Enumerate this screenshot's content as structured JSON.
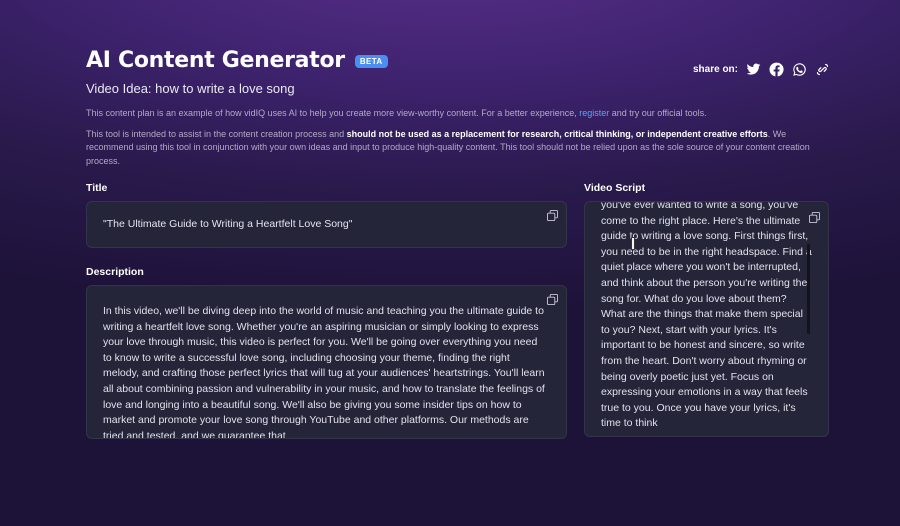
{
  "app": {
    "title": "AI Content Generator",
    "badge": "BETA"
  },
  "share": {
    "label": "share on:",
    "icons": [
      "twitter-icon",
      "facebook-icon",
      "whatsapp-icon",
      "link-icon"
    ]
  },
  "video_idea": "Video Idea: how to write a love song",
  "info": {
    "line1_before": "This content plan is an example of how vidIQ uses AI to help you create more view-worthy content. For a better experience, ",
    "line1_link": "register",
    "line1_after": " and try our official tools.",
    "line2_before": "This tool is intended to assist in the content creation process and ",
    "line2_bold": "should not be used as a replacement for research, critical thinking, or independent creative efforts",
    "line2_after": ". We recommend using this tool in conjunction with your own ideas and input to produce high-quality content. This tool should not be relied upon as the sole source of your content creation process."
  },
  "title_section": {
    "label": "Title",
    "value": "\"The Ultimate Guide to Writing a Heartfelt Love Song\""
  },
  "description_section": {
    "label": "Description",
    "value": "In this video, we'll be diving deep into the world of music and teaching you the ultimate guide to writing a heartfelt love song. Whether you're an aspiring musician or simply looking to express your love through music, this video is perfect for you. We'll be going over everything you need to know to write a successful love song, including choosing your theme, finding the right melody, and crafting those perfect lyrics that will tug at your audiences' heartstrings. You'll learn all about combining passion and vulnerability in your music, and how to translate the feelings of love and longing into a beautiful song. We'll also be giving you some insider tips on how to market and promote your love song through YouTube and other platforms. Our methods are tried and tested, and we guarantee that"
  },
  "script_section": {
    "label": "Video Script",
    "value": "you've ever wanted to write a song, you've come to the right place. Here's the ultimate guide to writing a love song. First things first, you need to be in the right headspace. Find a quiet place where you won't be interrupted, and think about the person you're writing the song for. What do you love about them? What are the things that make them special to you? Next, start with your lyrics. It's important to be honest and sincere, so write from the heart. Don't worry about rhyming or being overly poetic just yet. Focus on expressing your emotions in a way that feels true to you. Once you have your lyrics, it's time to think"
  },
  "colors": {
    "accent_link": "#5aa3ff",
    "badge": "#4a8ef0",
    "card_bg": "#242538"
  }
}
